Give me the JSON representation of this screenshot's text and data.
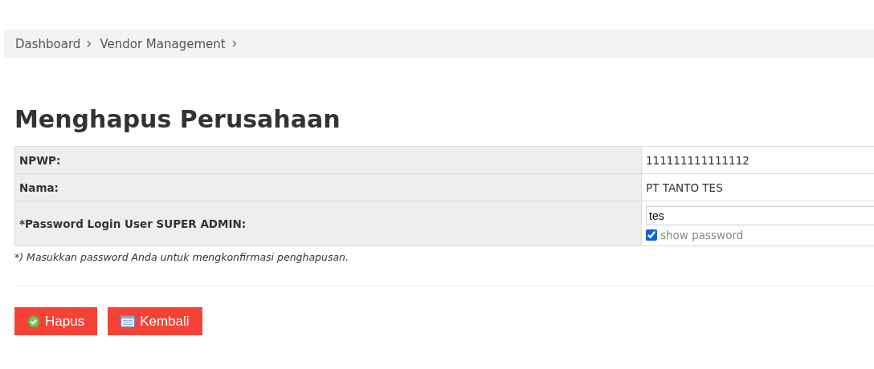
{
  "breadcrumb": [
    {
      "label": "Dashboard"
    },
    {
      "label": "Vendor Management"
    }
  ],
  "title": "Menghapus Perusahaan",
  "fields": [
    {
      "kind": "text",
      "label": "NPWP:",
      "value": "111111111111112"
    },
    {
      "kind": "text",
      "label": "Nama:",
      "value": "PT TANTO TES"
    },
    {
      "kind": "password",
      "label": "*Password Login User SUPER ADMIN:",
      "value": "tes",
      "show_password": {
        "label": "show password",
        "checked": true
      }
    }
  ],
  "note": "*) Masukkan password Anda untuk mengkonfirmasi penghapusan.",
  "buttons": [
    {
      "kind": "confirm",
      "label": "Hapus"
    },
    {
      "kind": "back",
      "label": "Kembali"
    }
  ]
}
